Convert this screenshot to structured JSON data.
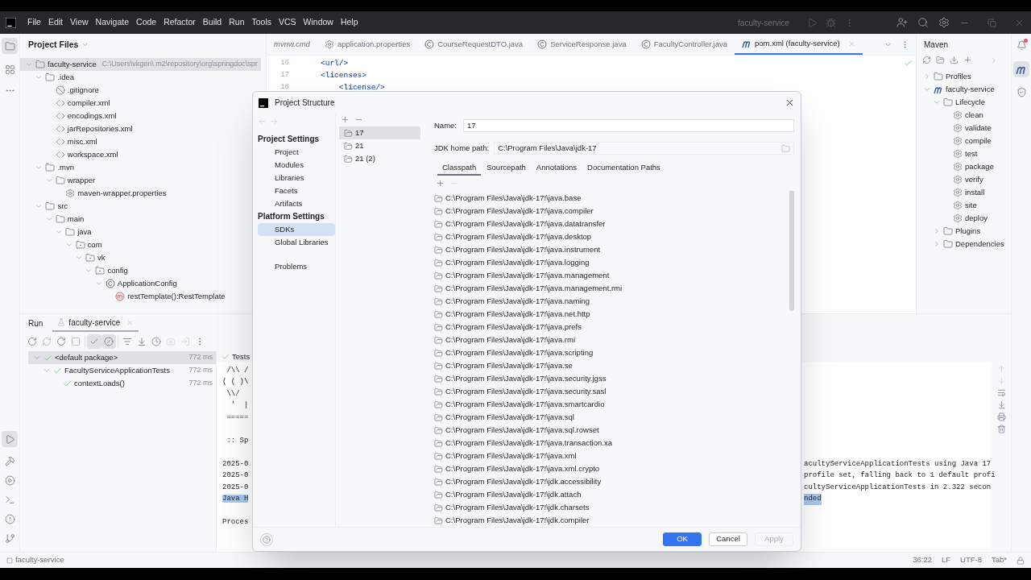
{
  "menu_bar": {
    "items": [
      "File",
      "Edit",
      "View",
      "Navigate",
      "Code",
      "Refactor",
      "Build",
      "Run",
      "Tools",
      "VCS",
      "Window",
      "Help"
    ],
    "project": "faculty-service"
  },
  "project_panel": {
    "title": "Project Files",
    "tree": [
      {
        "label": "faculty-service",
        "path": "C:\\Users\\vkgen\\.m2\\repository\\org\\springdoc\\spr",
        "kind": "module",
        "expanded": true,
        "selected": true,
        "children": [
          {
            "label": ".idea",
            "kind": "folder",
            "expanded": true,
            "selected": false,
            "children": [
              {
                "label": ".gitignore",
                "kind": "ignore",
                "selected": false
              },
              {
                "label": "compiler.xml",
                "kind": "xml",
                "selected": false
              },
              {
                "label": "encodings.xml",
                "kind": "xml",
                "selected": false
              },
              {
                "label": "jarRepositories.xml",
                "kind": "xml",
                "selected": false
              },
              {
                "label": "misc.xml",
                "kind": "xml",
                "selected": false
              },
              {
                "label": "workspace.xml",
                "kind": "xml",
                "selected": false
              }
            ]
          },
          {
            "label": ".mvn",
            "kind": "folder",
            "expanded": true,
            "selected": false,
            "children": [
              {
                "label": "wrapper",
                "kind": "folder",
                "expanded": true,
                "selected": false,
                "children": [
                  {
                    "label": "maven-wrapper.properties",
                    "kind": "properties",
                    "selected": false
                  }
                ]
              }
            ]
          },
          {
            "label": "src",
            "kind": "folder",
            "expanded": true,
            "selected": false,
            "children": [
              {
                "label": "main",
                "kind": "folder",
                "expanded": true,
                "selected": false,
                "children": [
                  {
                    "label": "java",
                    "kind": "folder",
                    "expanded": true,
                    "selected": false,
                    "children": [
                      {
                        "label": "com",
                        "kind": "package",
                        "expanded": true,
                        "selected": false,
                        "children": [
                          {
                            "label": "vk",
                            "kind": "package",
                            "expanded": true,
                            "selected": false,
                            "children": [
                              {
                                "label": "config",
                                "kind": "package",
                                "expanded": true,
                                "selected": false,
                                "children": [
                                  {
                                    "label": "ApplicationConfig",
                                    "kind": "class",
                                    "expanded": true,
                                    "selected": false,
                                    "children": [
                                      {
                                        "label": "restTemplate():RestTemplate",
                                        "kind": "method",
                                        "selected": false
                                      }
                                    ]
                                  }
                                ]
                              }
                            ]
                          }
                        ]
                      }
                    ]
                  }
                ]
              }
            ]
          }
        ]
      }
    ]
  },
  "editor": {
    "tabs": [
      {
        "label": "mvnw.cmd",
        "kind": "script",
        "preview": true,
        "selected": false
      },
      {
        "label": "application.properties",
        "kind": "properties",
        "preview": false,
        "selected": false
      },
      {
        "label": "CourseRequestDTO.java",
        "kind": "class",
        "preview": false,
        "selected": false
      },
      {
        "label": "ServiceResponse.java",
        "kind": "class",
        "preview": false,
        "selected": false
      },
      {
        "label": "FacultyController.java",
        "kind": "class",
        "preview": false,
        "selected": false
      },
      {
        "label": "pom.xml (faculty-service)",
        "kind": "maven",
        "preview": false,
        "selected": true
      }
    ],
    "lines": [
      {
        "number": "16",
        "text": "<url/>"
      },
      {
        "number": "17",
        "text": "<licenses>"
      },
      {
        "number": "18",
        "text": "    <license/>"
      }
    ]
  },
  "maven": {
    "title": "Maven",
    "tree": [
      {
        "label": "Profiles",
        "kind": "folder",
        "expanded": false
      },
      {
        "label": "faculty-service",
        "kind": "maven",
        "expanded": true,
        "children": [
          {
            "label": "Lifecycle",
            "kind": "folder",
            "expanded": true,
            "children": [
              {
                "label": "clean",
                "kind": "goal"
              },
              {
                "label": "validate",
                "kind": "goal"
              },
              {
                "label": "compile",
                "kind": "goal"
              },
              {
                "label": "test",
                "kind": "goal"
              },
              {
                "label": "package",
                "kind": "goal"
              },
              {
                "label": "verify",
                "kind": "goal"
              },
              {
                "label": "install",
                "kind": "goal"
              },
              {
                "label": "site",
                "kind": "goal"
              },
              {
                "label": "deploy",
                "kind": "goal"
              }
            ]
          },
          {
            "label": "Plugins",
            "kind": "folder",
            "expanded": false
          },
          {
            "label": "Dependencies",
            "kind": "folder",
            "expanded": false
          }
        ]
      }
    ]
  },
  "run_panel": {
    "title": "Run",
    "tabs": [
      {
        "label": "faculty-service",
        "selected": true
      }
    ],
    "show_passed": true,
    "show_ignored": true,
    "tests": [
      {
        "label": "<default package>",
        "time": "772 ms",
        "passed": true,
        "selected": true,
        "expanded": true,
        "children": [
          {
            "label": "FacultyServiceApplicationTests",
            "time": "772 ms",
            "passed": true,
            "selected": false,
            "expanded": true,
            "children": [
              {
                "label": "contextLoads()",
                "time": "772 ms",
                "passed": true,
                "selected": false
              }
            ]
          }
        ]
      }
    ],
    "console": {
      "header": "Tests",
      "lines": [
        {
          "kind": "text",
          "left": " /\\\\ /",
          "highlighted": false
        },
        {
          "kind": "text",
          "left": "( ( )\\",
          "highlighted": false
        },
        {
          "kind": "text",
          "left": " \\\\/",
          "highlighted": false
        },
        {
          "kind": "text",
          "left": "  '  |",
          "highlighted": false
        },
        {
          "kind": "text",
          "left": " =====",
          "highlighted": false
        },
        {
          "kind": "blank"
        },
        {
          "kind": "text",
          "left": " :: Sp",
          "highlighted": false
        },
        {
          "kind": "blank"
        },
        {
          "kind": "text",
          "left": "2025-0",
          "right": "acultyServiceApplicationTests using Java 17",
          "highlighted": false
        },
        {
          "kind": "text",
          "left": "2025-0",
          "right": "profile set, falling back to 1 default profi",
          "highlighted": false
        },
        {
          "kind": "text",
          "left": "2025-0",
          "right": "cultyServiceApplicationTests in 2.322 secon",
          "highlighted": false
        },
        {
          "kind": "text",
          "left": "Java H",
          "right": "nded",
          "highlighted": true
        },
        {
          "kind": "blank"
        },
        {
          "kind": "text",
          "left": "Proces",
          "highlighted": false
        }
      ]
    }
  },
  "status_bar": {
    "project": "faculty-service",
    "items": [
      "36:22",
      "LF",
      "UTF-8",
      "Tab*"
    ]
  },
  "dialog": {
    "title": "Project Structure",
    "nav": [
      {
        "heading": "Project Settings",
        "items": [
          {
            "label": "Project",
            "selected": false
          },
          {
            "label": "Modules",
            "selected": false
          },
          {
            "label": "Libraries",
            "selected": false
          },
          {
            "label": "Facets",
            "selected": false
          },
          {
            "label": "Artifacts",
            "selected": false
          }
        ]
      },
      {
        "heading": "Platform Settings",
        "items": [
          {
            "label": "SDKs",
            "selected": true
          },
          {
            "label": "Global Libraries",
            "selected": false
          }
        ]
      },
      {
        "items": [
          {
            "label": "Problems",
            "selected": false
          }
        ]
      }
    ],
    "sdks": [
      {
        "label": "17",
        "selected": true
      },
      {
        "label": "21",
        "selected": false
      },
      {
        "label": "21 (2)",
        "selected": false
      }
    ],
    "name_label": "Name:",
    "name": "17",
    "home_label": "JDK home path:",
    "home_path": "C:\\Program Files\\Java\\jdk-17",
    "tabs": [
      {
        "label": "Classpath",
        "selected": true
      },
      {
        "label": "Sourcepath",
        "selected": false
      },
      {
        "label": "Annotations",
        "selected": false
      },
      {
        "label": "Documentation Paths",
        "selected": false
      }
    ],
    "classpath": [
      "C:\\Program Files\\Java\\jdk-17!\\java.base",
      "C:\\Program Files\\Java\\jdk-17!\\java.compiler",
      "C:\\Program Files\\Java\\jdk-17!\\java.datatransfer",
      "C:\\Program Files\\Java\\jdk-17!\\java.desktop",
      "C:\\Program Files\\Java\\jdk-17!\\java.instrument",
      "C:\\Program Files\\Java\\jdk-17!\\java.logging",
      "C:\\Program Files\\Java\\jdk-17!\\java.management",
      "C:\\Program Files\\Java\\jdk-17!\\java.management.rmi",
      "C:\\Program Files\\Java\\jdk-17!\\java.naming",
      "C:\\Program Files\\Java\\jdk-17!\\java.net.http",
      "C:\\Program Files\\Java\\jdk-17!\\java.prefs",
      "C:\\Program Files\\Java\\jdk-17!\\java.rmi",
      "C:\\Program Files\\Java\\jdk-17!\\java.scripting",
      "C:\\Program Files\\Java\\jdk-17!\\java.se",
      "C:\\Program Files\\Java\\jdk-17!\\java.security.jgss",
      "C:\\Program Files\\Java\\jdk-17!\\java.security.sasl",
      "C:\\Program Files\\Java\\jdk-17!\\java.smartcardio",
      "C:\\Program Files\\Java\\jdk-17!\\java.sql",
      "C:\\Program Files\\Java\\jdk-17!\\java.sql.rowset",
      "C:\\Program Files\\Java\\jdk-17!\\java.transaction.xa",
      "C:\\Program Files\\Java\\jdk-17!\\java.xml",
      "C:\\Program Files\\Java\\jdk-17!\\java.xml.crypto",
      "C:\\Program Files\\Java\\jdk-17!\\jdk.accessibility",
      "C:\\Program Files\\Java\\jdk-17!\\jdk.attach",
      "C:\\Program Files\\Java\\jdk-17!\\jdk.charsets",
      "C:\\Program Files\\Java\\jdk-17!\\jdk.compiler"
    ],
    "buttons": [
      {
        "label": "OK",
        "primary": true,
        "disabled": false
      },
      {
        "label": "Cancel",
        "primary": false,
        "disabled": false
      },
      {
        "label": "Apply",
        "primary": false,
        "disabled": true
      }
    ]
  }
}
